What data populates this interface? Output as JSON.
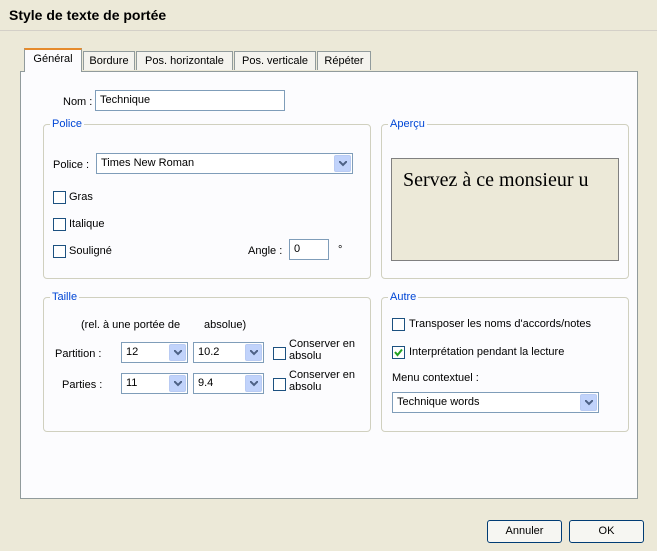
{
  "window": {
    "title": "Style de texte de portée"
  },
  "tabs": [
    {
      "label": "Général",
      "active": true
    },
    {
      "label": "Bordure",
      "active": false
    },
    {
      "label": "Pos. horizontale",
      "active": false
    },
    {
      "label": "Pos. verticale",
      "active": false
    },
    {
      "label": "Répéter",
      "active": false
    }
  ],
  "name": {
    "label": "Nom :",
    "value": "Technique"
  },
  "police_group": {
    "title": "Police",
    "font_label": "Police :",
    "font_value": "Times New Roman",
    "bold": {
      "label": "Gras",
      "checked": false
    },
    "italic": {
      "label": "Italique",
      "checked": false
    },
    "underline": {
      "label": "Souligné",
      "checked": false
    },
    "angle_label": "Angle :",
    "angle_value": "0",
    "angle_unit": "°"
  },
  "apercu_group": {
    "title": "Aperçu",
    "preview_text": "Servez à ce monsieur u"
  },
  "taille_group": {
    "title": "Taille",
    "header_rel": "(rel. à une portée de",
    "header_abs": "absolue)",
    "partition": {
      "label": "Partition :",
      "rel_value": "12",
      "abs_value": "10.2",
      "keep_label": "Conserver en absolu",
      "checked": false
    },
    "parties": {
      "label": "Parties :",
      "rel_value": "11",
      "abs_value": "9.4",
      "keep_label": "Conserver en absolu",
      "checked": false
    }
  },
  "autre_group": {
    "title": "Autre",
    "transpose": {
      "label": "Transposer les noms d'accords/notes",
      "checked": false
    },
    "playback": {
      "label": "Interprétation pendant la lecture",
      "checked": true
    },
    "context_menu_label": "Menu contextuel :",
    "context_menu_value": "Technique words"
  },
  "buttons": {
    "cancel": "Annuler",
    "ok": "OK"
  },
  "colors": {
    "accent": "#0046d5",
    "tab_highlight": "#e68b2c",
    "check": "#21a121"
  }
}
